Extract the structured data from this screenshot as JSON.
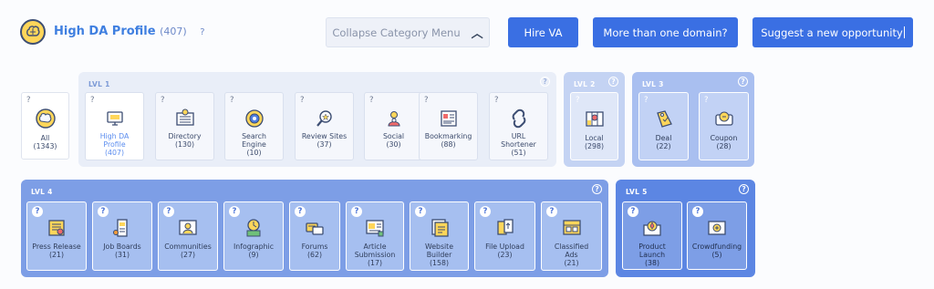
{
  "header": {
    "title": "High DA Profile",
    "count": "(407)",
    "help": "?",
    "collapse_label": "Collapse Category Menu",
    "hire_label": "Hire VA",
    "domain_label": "More than one domain?",
    "suggest_label": "Suggest a new opportunity"
  },
  "all_card": {
    "help": "?",
    "name": "All",
    "count": "(1343)"
  },
  "levels": {
    "lvl1": {
      "label": "LVL 1",
      "help": "?"
    },
    "lvl2": {
      "label": "LVL 2",
      "help": "?"
    },
    "lvl3": {
      "label": "LVL 3",
      "help": "?"
    },
    "lvl4": {
      "label": "LVL 4",
      "help": "?"
    },
    "lvl5": {
      "label": "LVL 5",
      "help": "?"
    }
  },
  "lvl1_items": [
    {
      "name": "High DA",
      "name2": "Profile",
      "count": "(407)",
      "icon": "monitor-icon",
      "help": "?"
    },
    {
      "name": "Directory",
      "name2": "",
      "count": "(130)",
      "icon": "directory-icon",
      "help": "?"
    },
    {
      "name": "Search",
      "name2": "Engine",
      "count": "(10)",
      "icon": "search-engine-icon",
      "help": "?"
    },
    {
      "name": "Review Sites",
      "name2": "",
      "count": "(37)",
      "icon": "magnifier-star-icon",
      "help": "?"
    },
    {
      "name": "Social",
      "name2": "",
      "count": "(30)",
      "icon": "people-icon",
      "help": "?"
    },
    {
      "name": "Bookmarking",
      "name2": "",
      "count": "(88)",
      "icon": "bookmark-icon",
      "help": "?"
    },
    {
      "name": "URL",
      "name2": "Shortener",
      "count": "(51)",
      "icon": "link-icon",
      "help": "?"
    }
  ],
  "lvl2_items": [
    {
      "name": "Local",
      "name2": "",
      "count": "(298)",
      "icon": "map-icon",
      "help": "?"
    }
  ],
  "lvl3_items": [
    {
      "name": "Deal",
      "name2": "",
      "count": "(22)",
      "icon": "tag-icon",
      "help": "?"
    },
    {
      "name": "Coupon",
      "name2": "",
      "count": "(28)",
      "icon": "coupon-icon",
      "help": "?"
    }
  ],
  "lvl4_items": [
    {
      "name": "Press Release",
      "name2": "",
      "count": "(21)",
      "icon": "press-icon",
      "help": "?"
    },
    {
      "name": "Job Boards",
      "name2": "",
      "count": "(31)",
      "icon": "job-board-icon",
      "help": "?"
    },
    {
      "name": "Communities",
      "name2": "",
      "count": "(27)",
      "icon": "community-icon",
      "help": "?"
    },
    {
      "name": "Infographic",
      "name2": "",
      "count": "(9)",
      "icon": "infographic-icon",
      "help": "?"
    },
    {
      "name": "Forums",
      "name2": "",
      "count": "(62)",
      "icon": "forum-icon",
      "help": "?"
    },
    {
      "name": "Article",
      "name2": "Submission",
      "count": "(17)",
      "icon": "article-icon",
      "help": "?"
    },
    {
      "name": "Website",
      "name2": "Builder",
      "count": "(158)",
      "icon": "website-builder-icon",
      "help": "?"
    },
    {
      "name": "File Upload",
      "name2": "",
      "count": "(23)",
      "icon": "file-upload-icon",
      "help": "?"
    },
    {
      "name": "Classified",
      "name2": "Ads",
      "count": "(21)",
      "icon": "classified-icon",
      "help": "?"
    }
  ],
  "lvl5_items": [
    {
      "name": "Product",
      "name2": "Launch",
      "count": "(38)",
      "icon": "rocket-icon",
      "help": "?"
    },
    {
      "name": "Crowdfunding",
      "name2": "",
      "count": "(5)",
      "icon": "crowdfunding-icon",
      "help": "?"
    }
  ],
  "colors": {
    "accent_blue": "#3a6fe3",
    "lvl1_bg": "#e9eef8",
    "lvl23_bg": "#a9bff0",
    "lvl45_bg": "#7d9ee6",
    "selected_text": "#5b8def",
    "icon_yellow": "#ffd65a"
  }
}
